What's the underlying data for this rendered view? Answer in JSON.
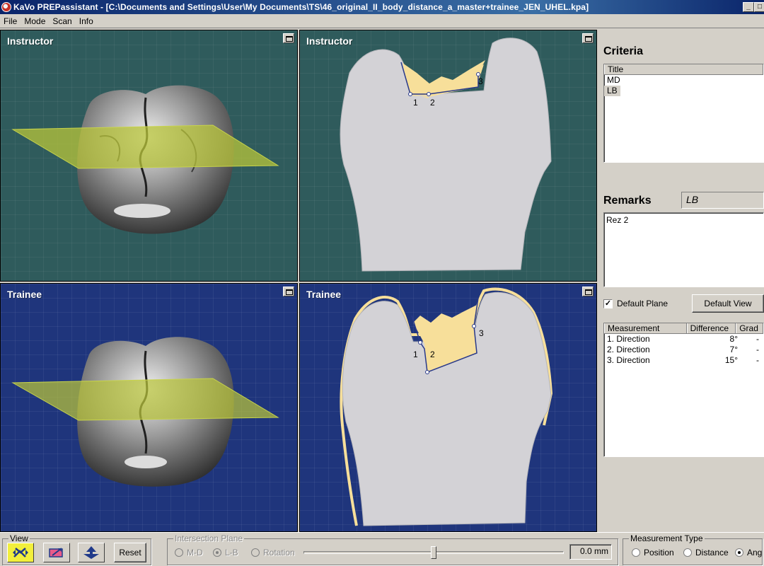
{
  "window": {
    "title": "KaVo PREPassistant - [C:\\Documents and Settings\\User\\My Documents\\TS\\46_original_II_body_distance_a_master+trainee_JEN_UHEL.kpa]"
  },
  "menu": [
    "File",
    "Mode",
    "Scan",
    "Info"
  ],
  "viewports": {
    "instructor_3d": {
      "label": "Instructor"
    },
    "instructor_section": {
      "label": "Instructor",
      "points": [
        "1",
        "2",
        "3"
      ]
    },
    "trainee_3d": {
      "label": "Trainee"
    },
    "trainee_section": {
      "label": "Trainee",
      "points": [
        "1",
        "2",
        "3"
      ]
    }
  },
  "panel": {
    "criteria_heading": "Criteria",
    "criteria_column": "Title",
    "criteria_items": [
      "MD",
      "LB"
    ],
    "criteria_selected": "LB",
    "remarks_heading": "Remarks",
    "remarks_field": "LB",
    "remarks_text": "Rez 2",
    "default_plane_label": "Default Plane",
    "default_plane_checked": true,
    "default_view_button": "Default View",
    "measurement_columns": [
      "Measurement",
      "Difference",
      "Grad"
    ],
    "measurements": [
      {
        "name": "1. Direction",
        "difference": "8°",
        "grade": "-"
      },
      {
        "name": "2. Direction",
        "difference": "7°",
        "grade": "-"
      },
      {
        "name": "3. Direction",
        "difference": "15°",
        "grade": "-"
      }
    ]
  },
  "toolbar": {
    "view_group": "View",
    "view_buttons": [
      "rotate-icon",
      "pan-icon",
      "zoom-icon"
    ],
    "reset_button": "Reset",
    "intersection_group": "Intersection Plane",
    "intersection_options": [
      "M-D",
      "L-B",
      "Rotation"
    ],
    "intersection_selected": "L-B",
    "slider_value": "0.0 mm",
    "measurement_type_group": "Measurement Type",
    "measurement_types": [
      "Position",
      "Distance",
      "Ang"
    ],
    "measurement_type_selected": "Ang"
  },
  "colors": {
    "teal_viewport": "#2f5b5c",
    "blue_viewport": "#1f357c",
    "tooth_section": "#d3d2d6",
    "cavity_fill": "#f7df9a",
    "plane": "#b8c43a"
  }
}
